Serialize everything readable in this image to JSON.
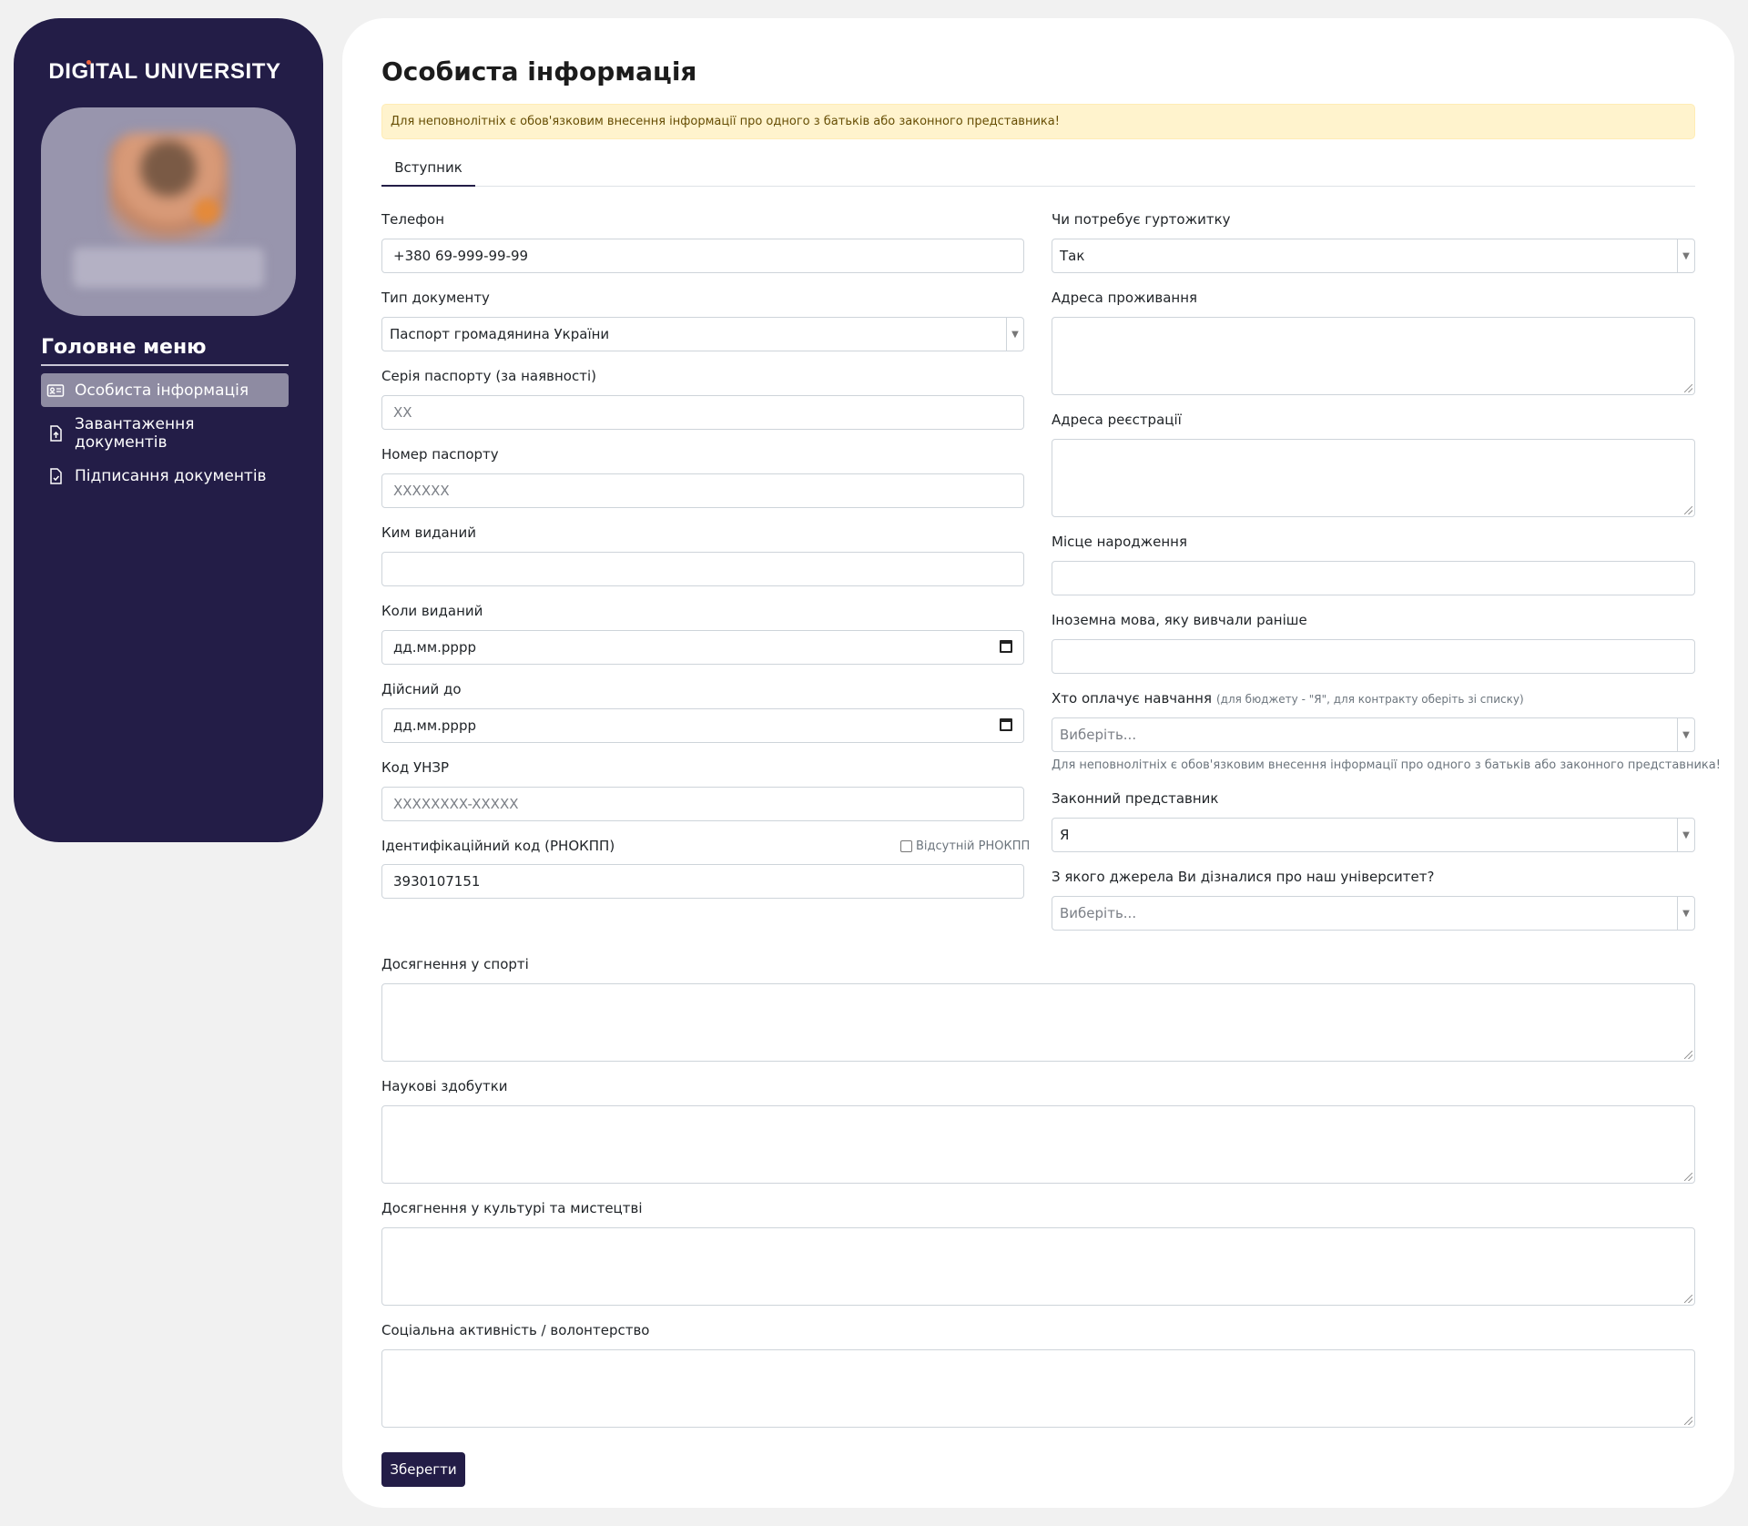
{
  "sidebar": {
    "brand": "DIGITAL UNIVERSITY",
    "menu_title": "Головне меню",
    "items": [
      {
        "label": "Особиста інформація",
        "icon": "id-card-icon",
        "active": true
      },
      {
        "label": "Завантаження документів",
        "icon": "file-upload-icon",
        "active": false
      },
      {
        "label": "Підписання документів",
        "icon": "file-sign-icon",
        "active": false
      }
    ]
  },
  "page": {
    "title": "Особиста інформація",
    "alert": "Для неповнолітніх є обов'язковим внесення інформації про одного з батьків або законного представника!",
    "tab": "Вступник"
  },
  "left": {
    "phone": {
      "label": "Телефон",
      "value": "+380 69-999-99-99"
    },
    "doc_type": {
      "label": "Тип документу",
      "value": "Паспорт громадянина України"
    },
    "passport_series": {
      "label": "Серія паспорту (за наявності)",
      "placeholder": "ХХ"
    },
    "passport_number": {
      "label": "Номер паспорту",
      "placeholder": "XXXXXX"
    },
    "issued_by": {
      "label": "Ким виданий",
      "value": ""
    },
    "issued_date": {
      "label": "Коли виданий",
      "value": "дд.мм.рррр"
    },
    "valid_until": {
      "label": "Дійсний до",
      "value": "дд.мм.рррр"
    },
    "unzr": {
      "label": "Код УНЗР",
      "placeholder": "XXXXXXXX-XXXXX"
    },
    "rnokpp": {
      "label": "Ідентифікаційний код (РНОКПП)",
      "value": "3930107151",
      "checkbox_label": "Відсутній РНОКПП",
      "checked": false
    }
  },
  "right": {
    "dormitory": {
      "label": "Чи потребує гуртожитку",
      "value": "Так"
    },
    "residence_address": {
      "label": "Адреса проживання"
    },
    "registration_address": {
      "label": "Адреса реєстрації"
    },
    "birth_place": {
      "label": "Місце народження"
    },
    "foreign_language": {
      "label": "Іноземна мова, яку вивчали раніше"
    },
    "payer": {
      "label": "Хто оплачує навчання",
      "hint": "(для бюджету - \"Я\", для контракту оберіть зі списку)",
      "placeholder": "Виберіть...",
      "help": "Для неповнолітніх є обов'язковим внесення інформації про одного з батьків або законного представника!"
    },
    "legal_rep": {
      "label": "Законний представник",
      "value": "Я"
    },
    "source": {
      "label": "З якого джерела Ви дізналися про наш університет?",
      "placeholder": "Виберіть..."
    }
  },
  "full": {
    "sport": {
      "label": "Досягнення у спорті"
    },
    "science": {
      "label": "Наукові здобутки"
    },
    "culture": {
      "label": "Досягнення у культурі та мистецтві"
    },
    "social": {
      "label": "Соціальна активність / волонтерство"
    }
  },
  "actions": {
    "save_label": "Зберегти"
  },
  "colors": {
    "sidebar": "#231d47",
    "active_item": "#8e8ba2",
    "alert_bg": "#fff3cd",
    "button": "#231d47"
  }
}
